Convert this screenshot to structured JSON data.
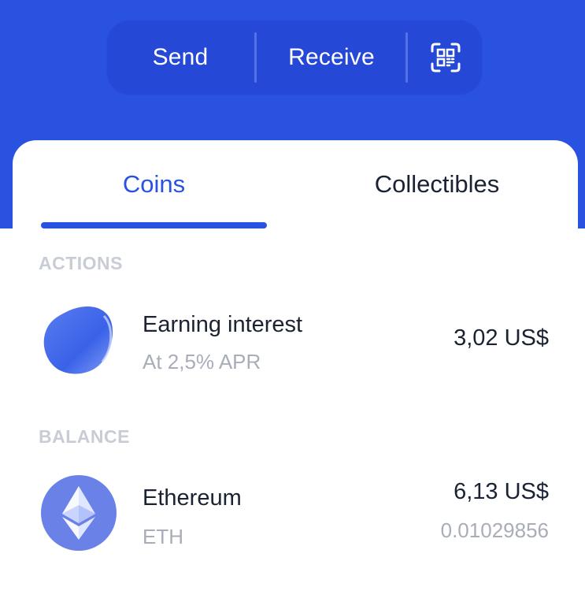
{
  "header": {
    "send_label": "Send",
    "receive_label": "Receive",
    "qr_icon": "qr-code-scan-icon"
  },
  "tabs": [
    {
      "label": "Coins",
      "active": true
    },
    {
      "label": "Collectibles",
      "active": false
    }
  ],
  "sections": {
    "actions": {
      "label": "ACTIONS",
      "items": [
        {
          "icon": "earning-blob-icon",
          "title": "Earning interest",
          "subtitle": "At 2,5% APR",
          "amount": "3,02 US$"
        }
      ]
    },
    "balance": {
      "label": "BALANCE",
      "items": [
        {
          "icon": "ethereum-icon",
          "title": "Ethereum",
          "subtitle": "ETH",
          "amount": "6,13 US$",
          "amount_sub": "0.01029856"
        }
      ]
    }
  },
  "colors": {
    "brand_blue": "#2a52e0",
    "pill_blue": "#2548d6",
    "text_dark": "#1a2233",
    "text_muted": "#a8adb8",
    "section_label": "#c8ccd4",
    "eth_circle": "#6a82e8"
  }
}
